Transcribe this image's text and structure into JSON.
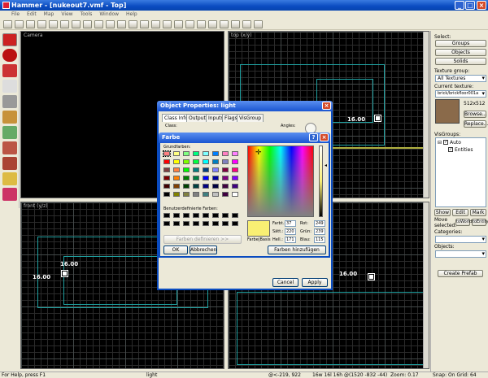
{
  "window": {
    "title": "Hammer - [nukeout7.vmf - Top]"
  },
  "menu": [
    "File",
    "Edit",
    "Map",
    "View",
    "Tools",
    "Window",
    "Help"
  ],
  "viewports": {
    "camera": "Camera",
    "top": "top (x/y)",
    "front": "front (y/z)",
    "side": ""
  },
  "map_labels": {
    "label_a": "16.00",
    "label_b": "16.00",
    "label_c": "16.00",
    "label_d": "16.00"
  },
  "right_panel": {
    "select_label": "Select:",
    "groups_btn": "Groups",
    "objects_btn": "Objects",
    "solids_btn": "Solids",
    "texture_group_label": "Texture group:",
    "texture_group_value": "All Textures",
    "current_texture_label": "Current texture:",
    "current_texture_value": "brick/brickfloor001a",
    "texture_size": "512x512",
    "browse_btn": "Browse...",
    "replace_btn": "Replace...",
    "visgroups_label": "VisGroups:",
    "vis_auto": "Auto",
    "vis_entities": "Entities",
    "show_btn": "Show",
    "edit_btn": "Edit",
    "mark_btn": "Mark",
    "move_selected": "Move selected:",
    "to_world_btn": "toWorld",
    "to_entity_btn": "toEntity",
    "categories_label": "Categories:",
    "objects_label": "Objects:",
    "create_prefab_btn": "Create Prefab"
  },
  "status": {
    "help": "For Help, press F1",
    "selection": "light",
    "coords": "@<-219, 922",
    "size": "16w 16l 16h @(1520 -832 -44)",
    "zoom": "Zoom: 0.17",
    "snap": "Snap: On Grid: 64"
  },
  "object_properties": {
    "title": "Object Properties: light",
    "tabs": [
      "Class Info",
      "Outputs",
      "Inputs",
      "Flags",
      "VisGroup"
    ],
    "class_label": "Class:",
    "angles_label": "Angles:",
    "cancel_btn": "Cancel",
    "apply_btn": "Apply"
  },
  "color_dialog": {
    "title": "Farbe",
    "help_glyph": "?",
    "basic_colors_label": "Grundfarben:",
    "custom_colors_label": "Benutzerdefinierte Farben:",
    "define_btn": "Farben definieren >>",
    "ok_btn": "OK",
    "cancel_btn": "Abbrechen",
    "color_solid_label": "Farbe|Basis",
    "hue_label": "Farbt.:",
    "hue": "37",
    "sat_label": "Sätt.:",
    "sat": "220",
    "lum_label": "Hell.:",
    "lum": "171",
    "red_label": "Rot:",
    "red": "249",
    "green_label": "Grün:",
    "green": "239",
    "blue_label": "Blau:",
    "blue": "115",
    "add_custom_btn": "Farben hinzufügen",
    "basic_colors": [
      "#ff8080",
      "#ffff80",
      "#80ff80",
      "#00ff80",
      "#80ffff",
      "#0080ff",
      "#ff80c0",
      "#ff80ff",
      "#ff0000",
      "#ffff00",
      "#80ff00",
      "#00ff40",
      "#00ffff",
      "#0080c0",
      "#8080c0",
      "#ff00ff",
      "#804040",
      "#ff8040",
      "#00ff00",
      "#008080",
      "#004080",
      "#8080ff",
      "#800040",
      "#ff0080",
      "#800000",
      "#ff8000",
      "#008000",
      "#008040",
      "#0000ff",
      "#0000a0",
      "#800080",
      "#8000ff",
      "#400000",
      "#804000",
      "#004000",
      "#004040",
      "#000080",
      "#000040",
      "#400040",
      "#400080",
      "#000000",
      "#808000",
      "#808040",
      "#808080",
      "#408080",
      "#c0c0c0",
      "#400040",
      "#ffffff"
    ],
    "selected_color": "#f9ef73"
  }
}
